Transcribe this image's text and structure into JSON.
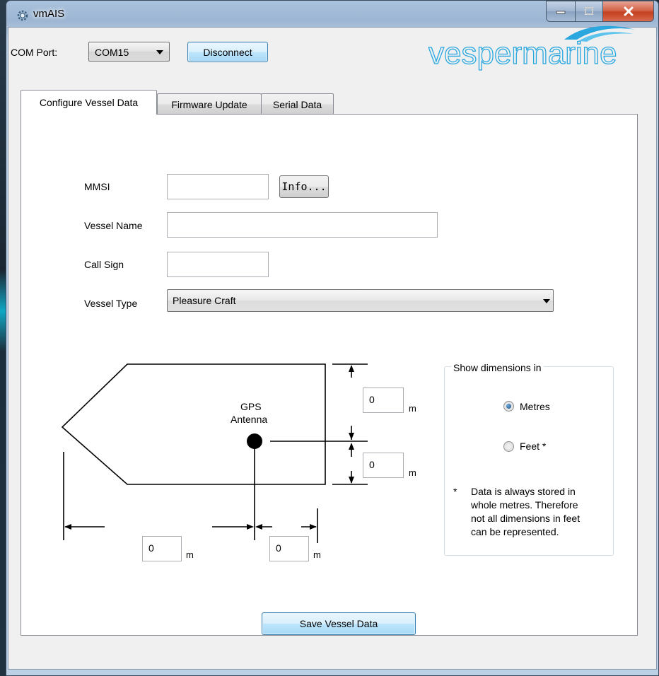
{
  "window": {
    "title": "vmAIS"
  },
  "toolbar": {
    "com_port_label": "COM Port:",
    "com_port_value": "COM15",
    "disconnect_label": "Disconnect"
  },
  "logo": {
    "text": "vespermarine",
    "color": "#29a8e0"
  },
  "tabs": [
    {
      "label": "Configure Vessel Data",
      "selected": true
    },
    {
      "label": "Firmware Update",
      "selected": false
    },
    {
      "label": "Serial Data",
      "selected": false
    }
  ],
  "form": {
    "mmsi_label": "MMSI",
    "mmsi_value": "",
    "info_label": "Info...",
    "vessel_name_label": "Vessel Name",
    "vessel_name_value": "",
    "call_sign_label": "Call Sign",
    "call_sign_value": "",
    "vessel_type_label": "Vessel Type",
    "vessel_type_value": "Pleasure Craft"
  },
  "diagram": {
    "gps_label_line1": "GPS",
    "gps_label_line2": "Antenna",
    "bow_distance": "0",
    "stern_distance": "0",
    "port_distance": "0",
    "starboard_distance": "0",
    "unit": "m"
  },
  "dimensions": {
    "group_title": "Show dimensions in",
    "metres_label": "Metres",
    "feet_label": "Feet *",
    "selected": "Metres",
    "note_star": "*",
    "note_line1": "Data is always stored in",
    "note_line2": "whole metres. Therefore",
    "note_line3": "not all dimensions in feet",
    "note_line4": "can be represented."
  },
  "save_label": "Save Vessel Data"
}
